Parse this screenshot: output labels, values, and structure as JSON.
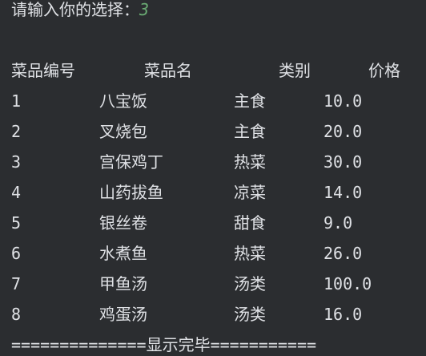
{
  "prompt": {
    "label": "请输入你的选择：",
    "value": "3"
  },
  "table": {
    "headers": {
      "id": "菜品编号",
      "name": "菜品名",
      "category": "类别",
      "price": "价格"
    },
    "rows": [
      {
        "id": "1",
        "name": "八宝饭",
        "category": "主食",
        "price": "10.0"
      },
      {
        "id": "2",
        "name": "叉烧包",
        "category": "主食",
        "price": "20.0"
      },
      {
        "id": "3",
        "name": "宫保鸡丁",
        "category": "热菜",
        "price": "30.0"
      },
      {
        "id": "4",
        "name": "山药拔鱼",
        "category": "凉菜",
        "price": "14.0"
      },
      {
        "id": "5",
        "name": "银丝卷",
        "category": "甜食",
        "price": "9.0"
      },
      {
        "id": "6",
        "name": "水煮鱼",
        "category": "热菜",
        "price": "26.0"
      },
      {
        "id": "7",
        "name": "甲鱼汤",
        "category": "汤类",
        "price": "100.0"
      },
      {
        "id": "8",
        "name": "鸡蛋汤",
        "category": "汤类",
        "price": "16.0"
      }
    ]
  },
  "footer": "==============显示完毕==========="
}
